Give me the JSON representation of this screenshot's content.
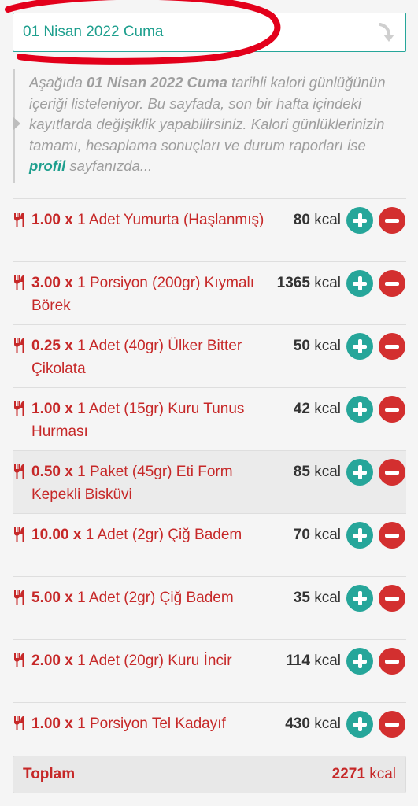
{
  "date_selector": {
    "value": "01 Nisan 2022 Cuma",
    "icon": "chevron-down-icon"
  },
  "info": {
    "text_1": "Aşağıda ",
    "date_bold": "01 Nisan 2022 Cuma",
    "text_2": " tarihli kalori günlüğünün içeriği listeleniyor. Bu sayfada, son bir hafta içindeki kayıtlarda değişiklik yapabilirsiniz. Kalori günlüklerinizin tamamı, hesaplama sonuçları ve durum raporları ise ",
    "link": "profil",
    "text_3": " sayfanızda..."
  },
  "entries": [
    {
      "qty": "1.00 x",
      "name": "1 Adet Yumurta (Haşlanmış)",
      "kcal": "80",
      "unit": "kcal"
    },
    {
      "qty": "3.00 x",
      "name": "1 Porsiyon (200gr) Kıymalı Börek",
      "kcal": "1365",
      "unit": "kcal"
    },
    {
      "qty": "0.25 x",
      "name": "1 Adet (40gr) Ülker Bitter Çikolata",
      "kcal": "50",
      "unit": "kcal"
    },
    {
      "qty": "1.00 x",
      "name": "1 Adet (15gr) Kuru Tunus Hurması",
      "kcal": "42",
      "unit": "kcal"
    },
    {
      "qty": "0.50 x",
      "name": "1 Paket (45gr) Eti Form Kepekli Bisküvi",
      "kcal": "85",
      "unit": "kcal"
    },
    {
      "qty": "10.00 x",
      "name": "1 Adet (2gr) Çiğ Badem",
      "kcal": "70",
      "unit": "kcal"
    },
    {
      "qty": "5.00 x",
      "name": "1 Adet (2gr) Çiğ Badem",
      "kcal": "35",
      "unit": "kcal"
    },
    {
      "qty": "2.00 x",
      "name": "1 Adet (20gr) Kuru İncir",
      "kcal": "114",
      "unit": "kcal"
    },
    {
      "qty": "1.00 x",
      "name": "1 Porsiyon Tel Kadayıf",
      "kcal": "430",
      "unit": "kcal"
    }
  ],
  "total": {
    "label": "Toplam",
    "value": "2271",
    "unit": "kcal"
  },
  "colors": {
    "accent": "#26a69a",
    "danger": "#d32f2f",
    "text_red": "#c62828",
    "annotation": "#e3001b"
  }
}
